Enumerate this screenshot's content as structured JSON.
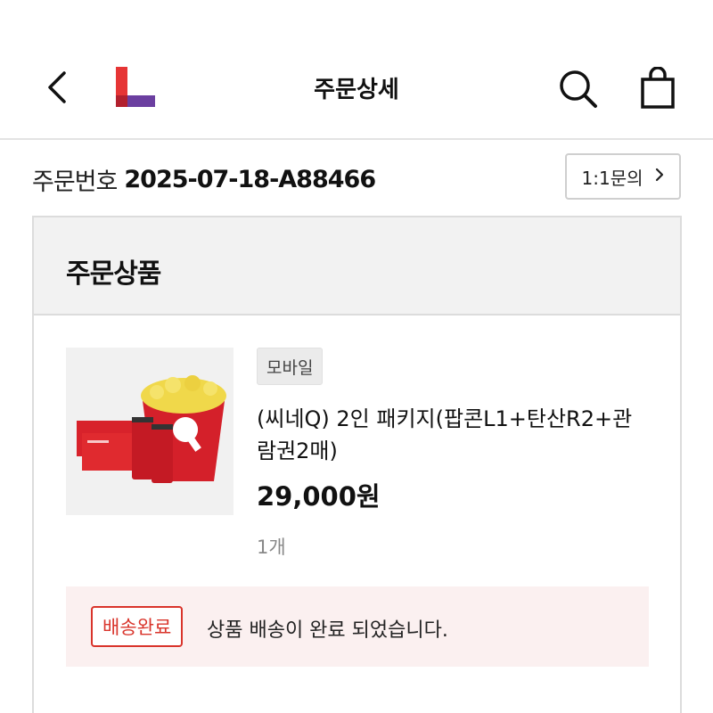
{
  "header": {
    "title": "주문상세",
    "back_icon": "chevron-left-icon",
    "logo_icon": "brand-logo",
    "search_icon": "search-icon",
    "cart_icon": "shopping-bag-icon"
  },
  "order": {
    "label": "주문번호",
    "number": "2025-07-18-A88466",
    "inquiry_label": "1:1문의"
  },
  "card": {
    "title": "주문상품",
    "product": {
      "badge": "모바일",
      "name": "(씨네Q) 2인 패키지(팝콘L1+탄산R2+관람권2매)",
      "price": "29,000원",
      "quantity": "1개"
    },
    "status": {
      "badge": "배송완료",
      "message": "상품 배송이 완료 되었습니다."
    }
  },
  "colors": {
    "logo_red": "#e63535",
    "logo_purple": "#6b3fa0",
    "status_red": "#d9342b",
    "status_bg": "#fbf0f0"
  }
}
